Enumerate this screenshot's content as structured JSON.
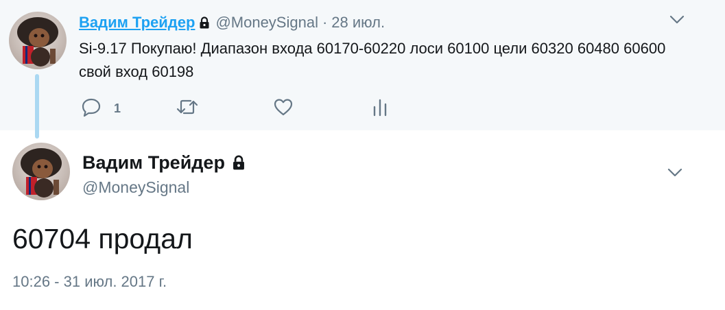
{
  "parent_tweet": {
    "author_name": "Вадим Трейдер",
    "handle": "@MoneySignal",
    "separator": "·",
    "time": "28 июл.",
    "text": "Si-9.17 Покупаю! Диапазон входа 60170-60220 лоси 60100 цели 60320 60480 60600 свой вход 60198",
    "reply_count": "1"
  },
  "main_tweet": {
    "author_name": "Вадим Трейдер",
    "handle": "@MoneySignal",
    "text": "60704 продал",
    "timestamp": "10:26 - 31 июл. 2017 г."
  },
  "icons": [
    "lock-icon",
    "chevron-down-icon",
    "reply-icon",
    "retweet-icon",
    "like-icon",
    "analytics-icon"
  ],
  "colors": {
    "link_blue": "#1da1f2",
    "secondary_text": "#657786",
    "parent_background": "#f5f8fa",
    "thread_line": "#aad8f2",
    "primary_text": "#14171a"
  }
}
